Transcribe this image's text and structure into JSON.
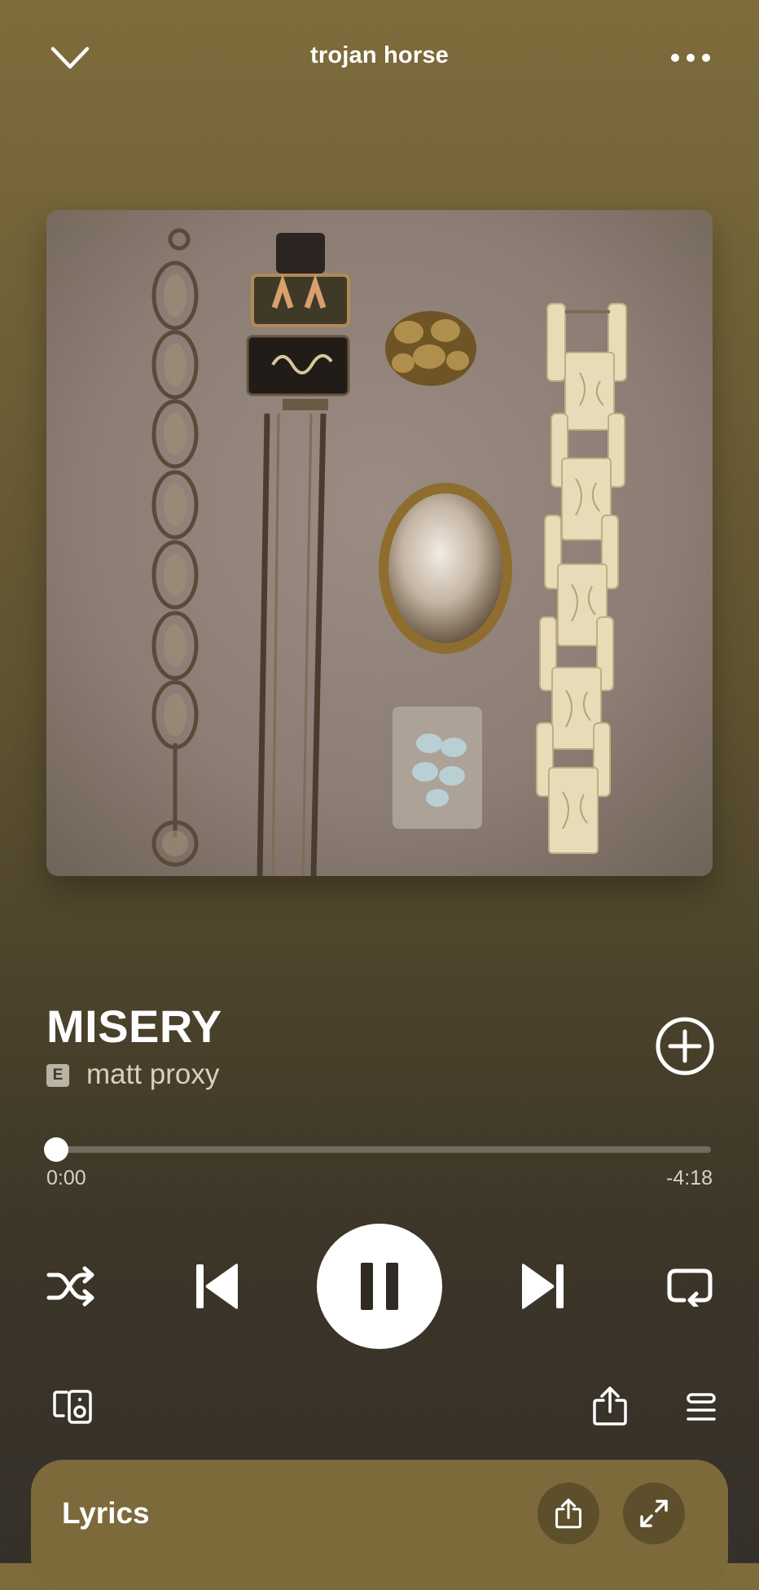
{
  "header": {
    "title": "trojan horse",
    "collapse_icon": "chevron-down-icon",
    "menu_icon": "more-horizontal-icon"
  },
  "album_art": {
    "alt": "album artwork"
  },
  "track": {
    "title": "MISERY",
    "explicit_badge": "E",
    "artist": "matt proxy",
    "add_icon": "plus-circle-icon"
  },
  "progress": {
    "elapsed": "0:00",
    "remaining": "-4:18",
    "fraction": 0.0
  },
  "controls": {
    "shuffle_icon": "shuffle-icon",
    "previous_icon": "skip-previous-icon",
    "play_state_icon": "pause-icon",
    "next_icon": "skip-next-icon",
    "repeat_icon": "repeat-icon"
  },
  "secondary": {
    "devices_icon": "devices-icon",
    "share_icon": "share-icon",
    "queue_icon": "queue-icon"
  },
  "lyrics": {
    "label": "Lyrics",
    "share_icon": "share-icon",
    "expand_icon": "expand-icon"
  },
  "colors": {
    "background_top": "#7e6c3c",
    "background_bottom": "#35302a",
    "lyrics_card": "#7d6a3b",
    "accent": "#ffffff"
  }
}
